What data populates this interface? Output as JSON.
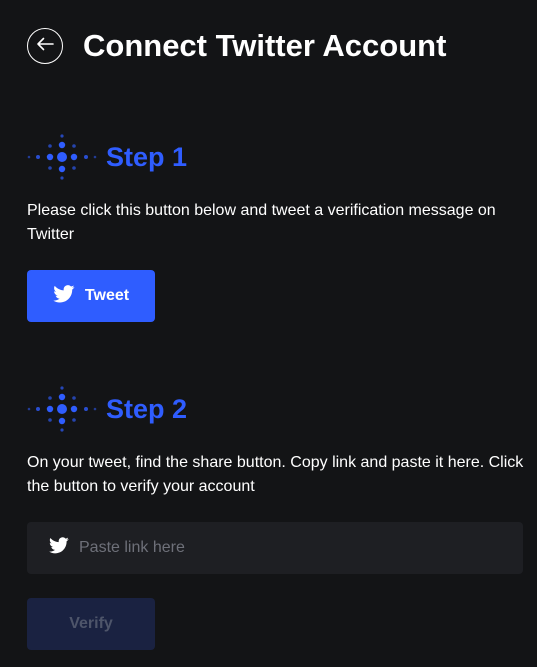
{
  "header": {
    "back_icon": "arrow-left-circle-icon",
    "title": "Connect Twitter Account"
  },
  "step1": {
    "icon": "dot-grid-icon",
    "title": "Step 1",
    "description": "Please click this button below and tweet a verification message on Twitter",
    "button_icon": "twitter-bird-icon",
    "button_label": "Tweet"
  },
  "step2": {
    "icon": "dot-grid-icon",
    "title": "Step 2",
    "description": "On your tweet, find the share button. Copy link and paste it here. Click the button to verify your account",
    "input_icon": "twitter-bird-icon",
    "input_value": "",
    "input_placeholder": "Paste link here",
    "verify_label": "Verify",
    "verify_state": "disabled"
  },
  "colors": {
    "background": "#131416",
    "accent": "#2f5dff",
    "input_background": "#1e1f23",
    "disabled_button": "#1a2241",
    "disabled_text": "#4e556a"
  }
}
